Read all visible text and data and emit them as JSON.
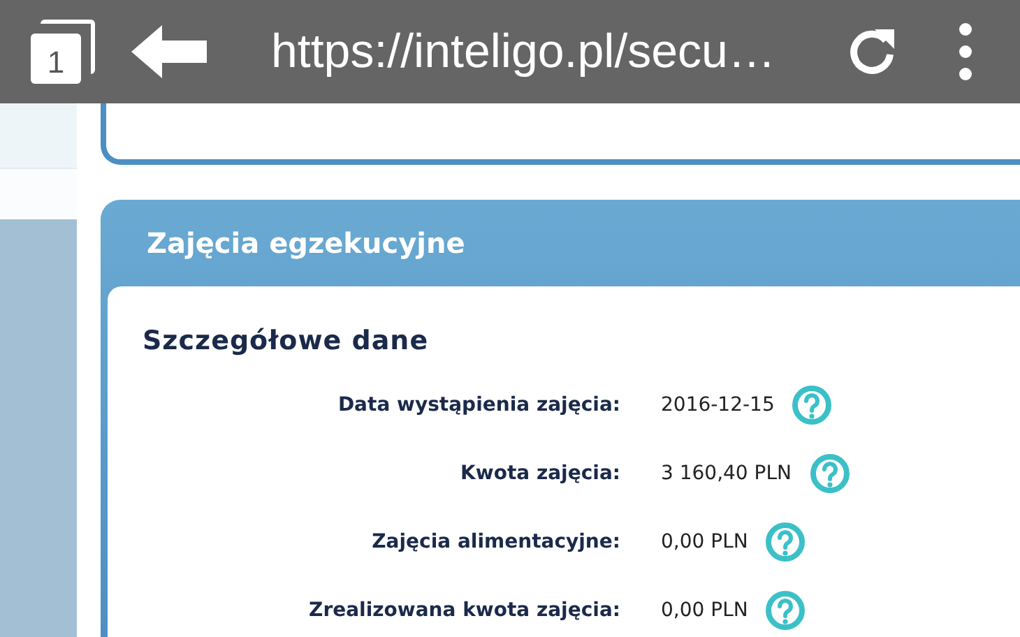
{
  "browser_bar": {
    "tab_count": "1",
    "url": "https://inteligo.pl/secu…"
  },
  "section": {
    "title": "Zajęcia egzekucyjne",
    "subtitle": "Szczegółowe dane",
    "rows": [
      {
        "label": "Data wystąpienia zajęcia:",
        "value": "2016-12-15"
      },
      {
        "label": "Kwota zajęcia:",
        "value": "3 160,40 PLN"
      },
      {
        "label": "Zajęcia alimentacyjne:",
        "value": "0,00 PLN"
      },
      {
        "label": "Zrealizowana kwota zajęcia:",
        "value": "0,00 PLN"
      }
    ]
  }
}
